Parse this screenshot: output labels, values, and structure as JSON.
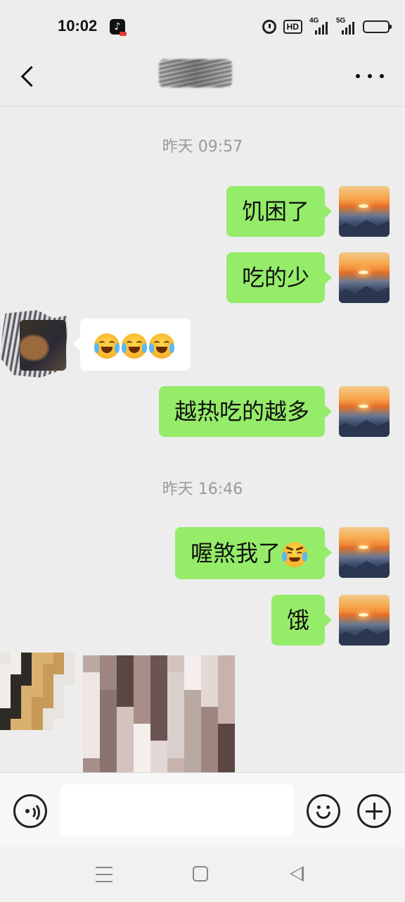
{
  "status_bar": {
    "time": "10:02",
    "icons": [
      "tiktok-icon",
      "alarm-icon",
      "hd-icon",
      "signal-4g-icon",
      "signal-5g-icon",
      "battery-icon"
    ],
    "hd_label": "HD",
    "net1_label": "4G",
    "net2_label": "5G"
  },
  "header": {
    "back_icon": "chevron-left-icon",
    "contact_name_redacted": true,
    "more_icon": "more-dots-icon"
  },
  "messages": [
    {
      "type": "timestamp",
      "text": "昨天 09:57"
    },
    {
      "type": "sent",
      "text": "饥困了"
    },
    {
      "type": "sent",
      "text": "吃的少"
    },
    {
      "type": "received",
      "emojis": [
        "loudly-crying-emoji",
        "loudly-crying-emoji",
        "loudly-crying-emoji"
      ]
    },
    {
      "type": "sent",
      "text": "越热吃的越多"
    },
    {
      "type": "timestamp",
      "text": "昨天 16:46"
    },
    {
      "type": "sent",
      "text": "喔煞我了",
      "trailing_emoji": "angry-crying-emoji"
    },
    {
      "type": "sent",
      "text": "饿"
    },
    {
      "type": "received-image",
      "content": "pixelated-image"
    }
  ],
  "input_bar": {
    "voice_icon": "voice-icon",
    "input_value": "",
    "emoji_icon": "emoji-icon",
    "plus_icon": "plus-icon"
  },
  "system_nav": {
    "icons": [
      "menu-icon",
      "home-icon",
      "back-triangle-icon"
    ]
  },
  "colors": {
    "background": "#ededed",
    "sent_bubble": "#95ec69",
    "received_bubble": "#ffffff",
    "timestamp_text": "#9a9a9a"
  }
}
